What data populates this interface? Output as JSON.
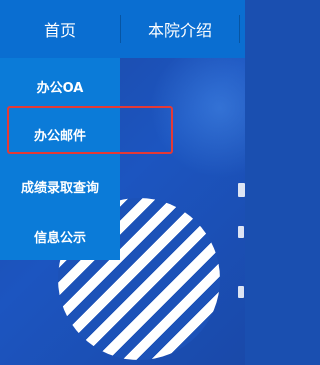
{
  "nav": {
    "items": [
      {
        "label": "首页"
      },
      {
        "label": "本院介绍"
      }
    ]
  },
  "dropdown": {
    "items": [
      {
        "label": "办公OA"
      },
      {
        "label": "办公邮件"
      },
      {
        "label": "成绩录取查询"
      },
      {
        "label": "信息公示"
      }
    ],
    "highlighted_item": "成绩录取查询",
    "highlight_color": "#e53935"
  },
  "colors": {
    "nav_bg": "#0a6ed1",
    "dropdown_bg": "#0b7bd8",
    "banner_bg": "#1c55c0"
  }
}
